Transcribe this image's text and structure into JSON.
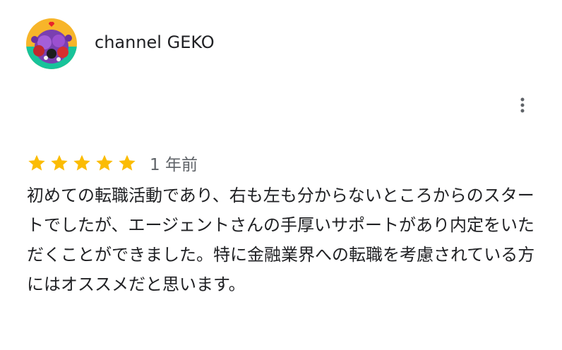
{
  "review": {
    "author_name": "channel GEKO",
    "avatar_icon": "profile-avatar",
    "more_icon": "more-vertical-icon",
    "rating": 5,
    "rating_max": 5,
    "date": "1 年前",
    "text": "初めての転職活動であり、右も左も分からないところからのスタートでしたが、エージェントさんの手厚いサポートがあり内定をいただくことができました。特に金融業界への転職を考慮されている方にはオススメだと思います。"
  },
  "colors": {
    "star": "#fbbc04",
    "text": "#202124",
    "muted": "#5f6368"
  }
}
